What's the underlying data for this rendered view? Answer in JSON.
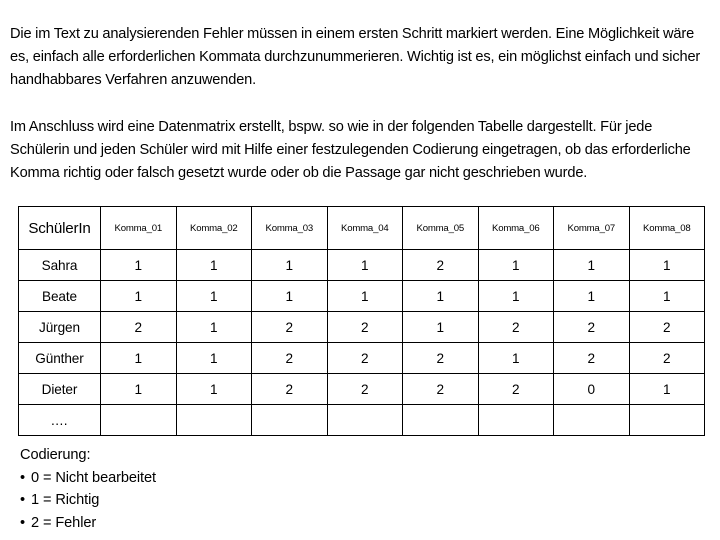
{
  "paragraphs": {
    "intro": "Die im Text zu analysierenden Fehler müssen in einem ersten Schritt markiert werden. Eine Möglichkeit wäre es, einfach alle erforderlichen Kommata durchzunummerieren. Wichtig ist es, ein möglichst einfach und sicher handhabbares Verfahren anzuwenden.",
    "matrix": "Im Anschluss wird eine Datenmatrix erstellt, bspw. so wie in der folgenden Tabelle dargestellt. Für jede Schülerin und jeden Schüler wird mit Hilfe einer festzulegenden Codierung eingetragen, ob das erforderliche Komma richtig oder falsch gesetzt wurde oder ob die Passage gar nicht geschrieben wurde."
  },
  "table": {
    "headers": [
      "SchülerIn",
      "Komma_01",
      "Komma_02",
      "Komma_03",
      "Komma_04",
      "Komma_05",
      "Komma_06",
      "Komma_07",
      "Komma_08"
    ],
    "rows": [
      {
        "name": "Sahra",
        "values": [
          "1",
          "1",
          "1",
          "1",
          "2",
          "1",
          "1",
          "1"
        ]
      },
      {
        "name": "Beate",
        "values": [
          "1",
          "1",
          "1",
          "1",
          "1",
          "1",
          "1",
          "1"
        ]
      },
      {
        "name": "Jürgen",
        "values": [
          "2",
          "1",
          "2",
          "2",
          "1",
          "2",
          "2",
          "2"
        ]
      },
      {
        "name": "Günther",
        "values": [
          "1",
          "1",
          "2",
          "2",
          "2",
          "1",
          "2",
          "2"
        ]
      },
      {
        "name": "Dieter",
        "values": [
          "1",
          "1",
          "2",
          "2",
          "2",
          "2",
          "0",
          "1"
        ]
      },
      {
        "name": "....",
        "values": [
          "",
          "",
          "",
          "",
          "",
          "",
          "",
          ""
        ]
      }
    ]
  },
  "legend": {
    "title": "Codierung:",
    "bullet": "•",
    "items": [
      "0 = Nicht bearbeitet",
      "1 = Richtig",
      "2 = Fehler"
    ]
  }
}
